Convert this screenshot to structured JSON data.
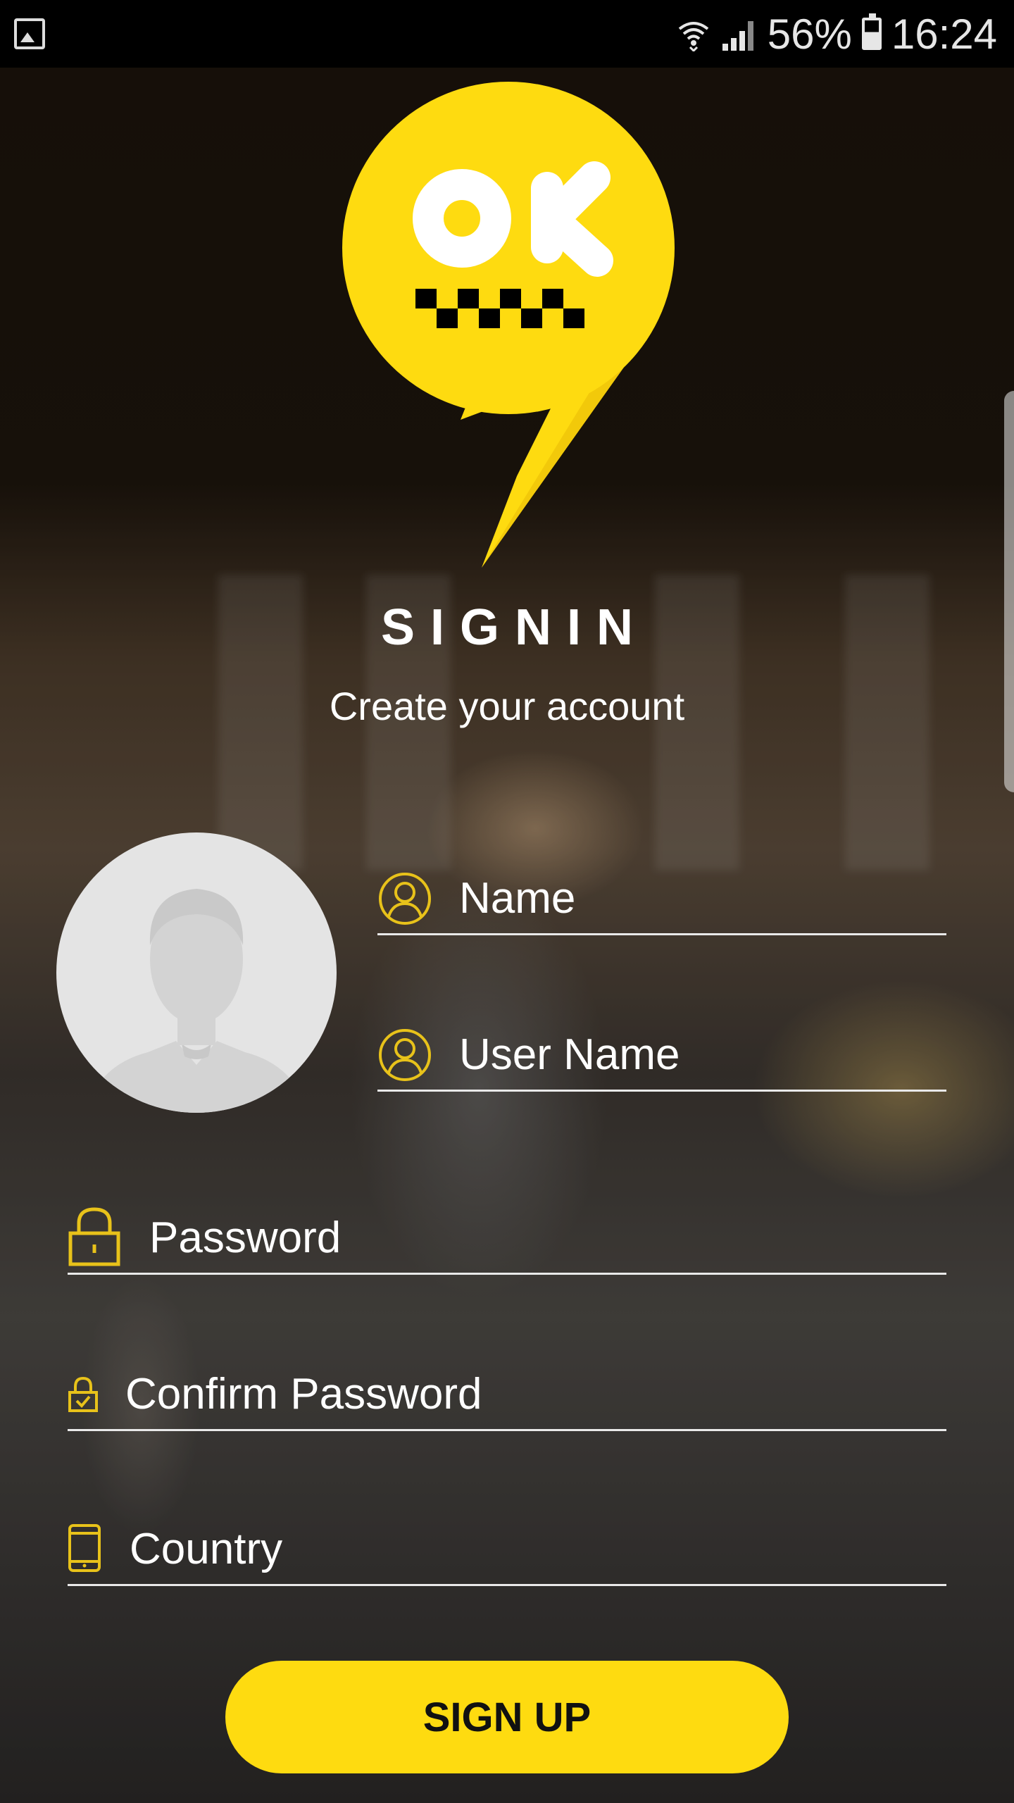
{
  "status_bar": {
    "battery_percent": "56%",
    "time": "16:24",
    "icons": [
      "gallery-notification-icon",
      "wifi-icon",
      "signal-icon",
      "battery-icon"
    ]
  },
  "logo": {
    "text": "OK",
    "colors": {
      "yellow": "#fedb10",
      "white": "#ffffff",
      "checker": "#000000"
    }
  },
  "header": {
    "title": "SIGNIN",
    "subtitle": "Create your account"
  },
  "form": {
    "name": {
      "placeholder": "Name",
      "icon": "user-circle-icon"
    },
    "username": {
      "placeholder": "User Name",
      "icon": "user-circle-icon"
    },
    "password": {
      "placeholder": "Password",
      "icon": "padlock-icon"
    },
    "confirm_password": {
      "placeholder": "Confirm Password",
      "icon": "padlock-check-icon"
    },
    "country": {
      "placeholder": "Country",
      "icon": "phone-icon"
    }
  },
  "avatar": {
    "icon": "default-user-avatar-icon"
  },
  "signup_button": {
    "label": "SIGN UP"
  },
  "colors": {
    "accent": "#fedb10",
    "underline": "#e9e9e9",
    "icon_gold": "#e8c21a"
  }
}
